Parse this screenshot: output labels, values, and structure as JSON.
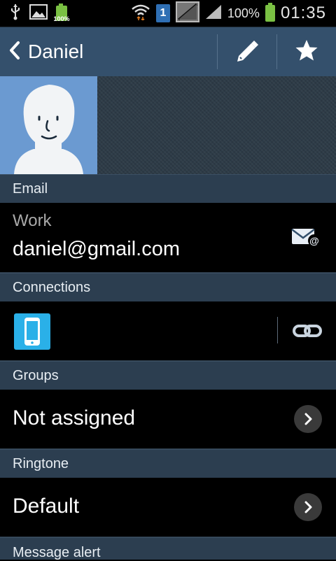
{
  "status_bar": {
    "battery_left_label": "100%",
    "sim_number": "1",
    "battery_percent": "100%",
    "time": "01:35"
  },
  "action_bar": {
    "title": "Daniel"
  },
  "sections": {
    "email": {
      "header": "Email",
      "type_label": "Work",
      "value": "daniel@gmail.com"
    },
    "connections": {
      "header": "Connections"
    },
    "groups": {
      "header": "Groups",
      "value": "Not assigned"
    },
    "ringtone": {
      "header": "Ringtone",
      "value": "Default"
    },
    "message_alert": {
      "header": "Message alert"
    }
  },
  "colors": {
    "action_bar": "#34506c",
    "section_header": "#2c3e50",
    "accent_blue": "#2ab0e8",
    "battery_green": "#7ac043"
  }
}
